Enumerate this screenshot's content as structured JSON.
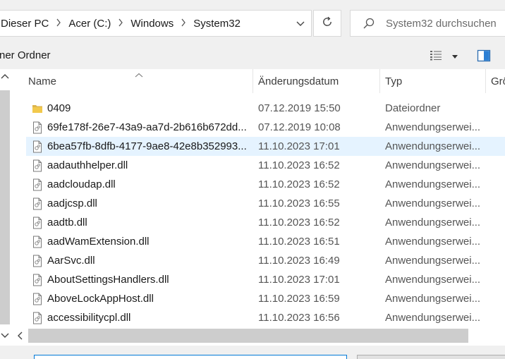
{
  "breadcrumb": [
    "Dieser PC",
    "Acer (C:)",
    "Windows",
    "System32"
  ],
  "search": {
    "placeholder": "System32 durchsuchen"
  },
  "toolbar": {
    "left_label": "ner Ordner"
  },
  "columns": {
    "name": "Name",
    "date": "Änderungsdatum",
    "type": "Typ",
    "size": "Grö"
  },
  "files": [
    {
      "name": "0409",
      "date": "07.12.2019 15:50",
      "type": "Dateiordner",
      "icon": "folder-icon"
    },
    {
      "name": "69fe178f-26e7-43a9-aa7d-2b616b672dd...",
      "date": "07.12.2019 10:08",
      "type": "Anwendungserwei...",
      "icon": "file-icon"
    },
    {
      "name": "6bea57fb-8dfb-4177-9ae8-42e8b352993...",
      "date": "11.10.2023 17:01",
      "type": "Anwendungserwei...",
      "icon": "file-icon",
      "selected": true
    },
    {
      "name": "aadauthhelper.dll",
      "date": "11.10.2023 16:52",
      "type": "Anwendungserwei...",
      "icon": "file-icon"
    },
    {
      "name": "aadcloudap.dll",
      "date": "11.10.2023 16:52",
      "type": "Anwendungserwei...",
      "icon": "file-icon"
    },
    {
      "name": "aadjcsp.dll",
      "date": "11.10.2023 16:55",
      "type": "Anwendungserwei...",
      "icon": "file-icon"
    },
    {
      "name": "aadtb.dll",
      "date": "11.10.2023 16:52",
      "type": "Anwendungserwei...",
      "icon": "file-icon"
    },
    {
      "name": "aadWamExtension.dll",
      "date": "11.10.2023 16:51",
      "type": "Anwendungserwei...",
      "icon": "file-icon"
    },
    {
      "name": "AarSvc.dll",
      "date": "11.10.2023 16:49",
      "type": "Anwendungserwei...",
      "icon": "file-icon"
    },
    {
      "name": "AboutSettingsHandlers.dll",
      "date": "11.10.2023 17:01",
      "type": "Anwendungserwei...",
      "icon": "file-icon"
    },
    {
      "name": "AboveLockAppHost.dll",
      "date": "11.10.2023 16:59",
      "type": "Anwendungserwei...",
      "icon": "file-icon"
    },
    {
      "name": "accessibilitycpl.dll",
      "date": "11.10.2023 16:56",
      "type": "Anwendungserwei...",
      "icon": "file-icon"
    }
  ],
  "colors": {
    "selection": "#e5f3ff",
    "accent": "#0078d7",
    "folder": "#dcb64f"
  }
}
